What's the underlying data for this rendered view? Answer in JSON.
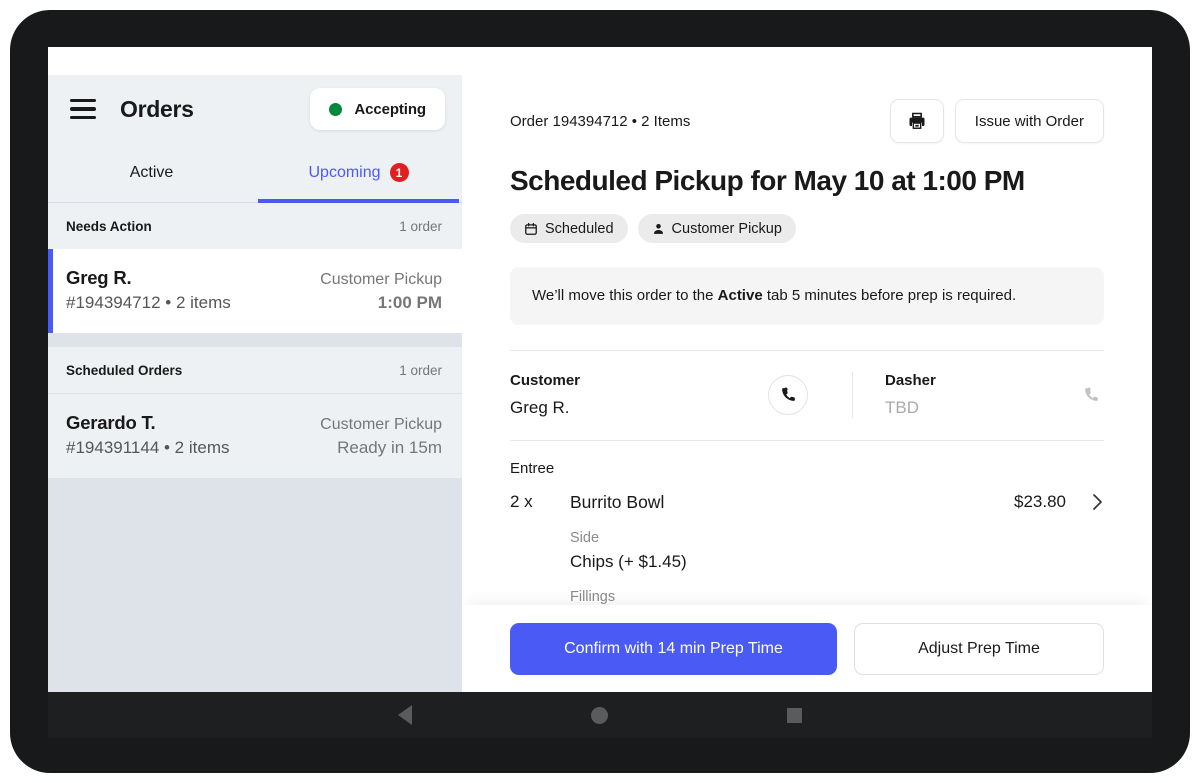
{
  "sidebar": {
    "menu_icon": "hamburger-menu-icon",
    "title": "Orders",
    "status_toggle": {
      "label": "Accepting",
      "dot_color": "#00893d"
    },
    "tabs": [
      {
        "label": "Active",
        "active": false,
        "badge": null
      },
      {
        "label": "Upcoming",
        "active": true,
        "badge": "1"
      }
    ],
    "groups": [
      {
        "title": "Needs Action",
        "count": "1 order",
        "orders": [
          {
            "name": "Greg R.",
            "sub": "#194394712 • 2 items",
            "type": "Customer Pickup",
            "time": "1:00 PM",
            "selected": true
          }
        ]
      },
      {
        "title": "Scheduled Orders",
        "count": "1 order",
        "orders": [
          {
            "name": "Gerardo T.",
            "sub": "#194391144 • 2 items",
            "type": "Customer Pickup",
            "time": "Ready in 15m",
            "selected": false
          }
        ]
      }
    ]
  },
  "detail": {
    "meta": "Order 194394712 • 2 Items",
    "print_icon": "printer-icon",
    "issue_button": "Issue with Order",
    "title": "Scheduled Pickup for May 10 at 1:00 PM",
    "chips": [
      {
        "icon": "calendar-icon",
        "label": "Scheduled"
      },
      {
        "icon": "person-icon",
        "label": "Customer Pickup"
      }
    ],
    "notice": {
      "before": "We’ll move this order to the ",
      "bold": "Active",
      "after": " tab 5 minutes before prep is required."
    },
    "customer": {
      "role": "Customer",
      "name": "Greg R.",
      "call_icon": "phone-icon"
    },
    "dasher": {
      "role": "Dasher",
      "name": "TBD",
      "call_icon": "phone-icon-disabled"
    },
    "items_section_label": "Entree",
    "item": {
      "qty": "2 x",
      "name": "Burrito Bowl",
      "price": "$23.80",
      "chevron_icon": "chevron-right-icon",
      "options": [
        {
          "label": "Side",
          "value": "Chips (+ $1.45)"
        },
        {
          "label": "Fillings",
          "value": ""
        }
      ]
    }
  },
  "footer": {
    "primary_button": "Confirm with 14 min Prep Time",
    "secondary_button": "Adjust Prep Time"
  },
  "navbar": {
    "back_icon": "android-back-icon",
    "home_icon": "android-home-icon",
    "recent_icon": "android-recents-icon"
  },
  "colors": {
    "accent": "#4a5bf5",
    "badge": "#e02020",
    "accepting_dot": "#00893d"
  }
}
